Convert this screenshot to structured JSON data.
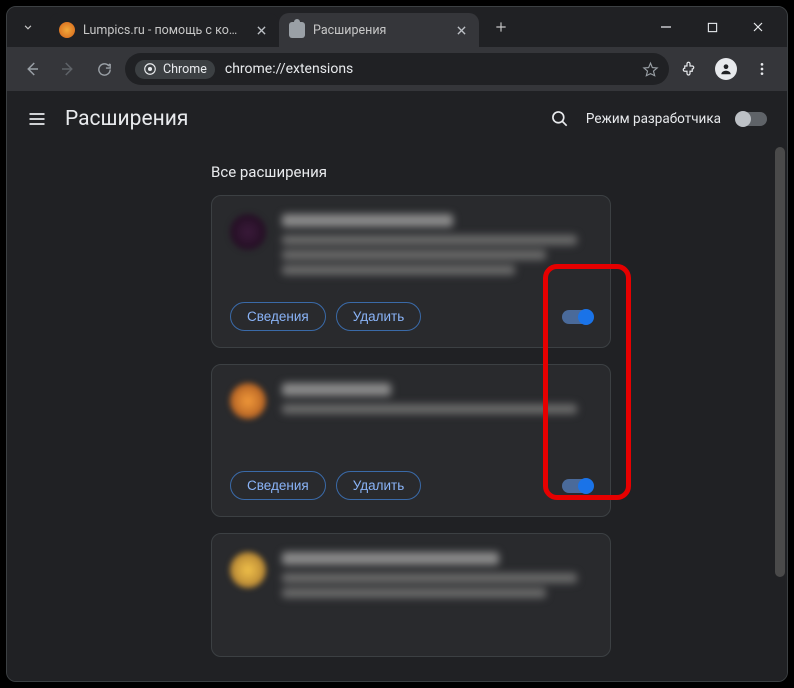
{
  "tabs": [
    {
      "title": "Lumpics.ru - помощь с компь",
      "active": false
    },
    {
      "title": "Расширения",
      "active": true
    }
  ],
  "toolbar": {
    "badge_label": "Chrome",
    "url": "chrome://extensions"
  },
  "page": {
    "title": "Расширения",
    "dev_mode_label": "Режим разработчика",
    "section_title": "Все расширения"
  },
  "card_buttons": {
    "details": "Сведения",
    "remove": "Удалить"
  },
  "extensions": [
    {
      "icon_bg": "radial-gradient(circle at 50% 50%, #3a1a3a, #1a0a1a)",
      "enabled": true,
      "desc_lines": 3,
      "name_w": "55%"
    },
    {
      "icon_bg": "radial-gradient(circle at 50% 50%, #f29a3a, #9a4a1a)",
      "enabled": true,
      "desc_lines": 1,
      "name_w": "35%"
    },
    {
      "icon_bg": "radial-gradient(circle at 50% 50%, #f2c24a, #9a6a2a)",
      "enabled": true,
      "desc_lines": 2,
      "name_w": "70%"
    }
  ]
}
